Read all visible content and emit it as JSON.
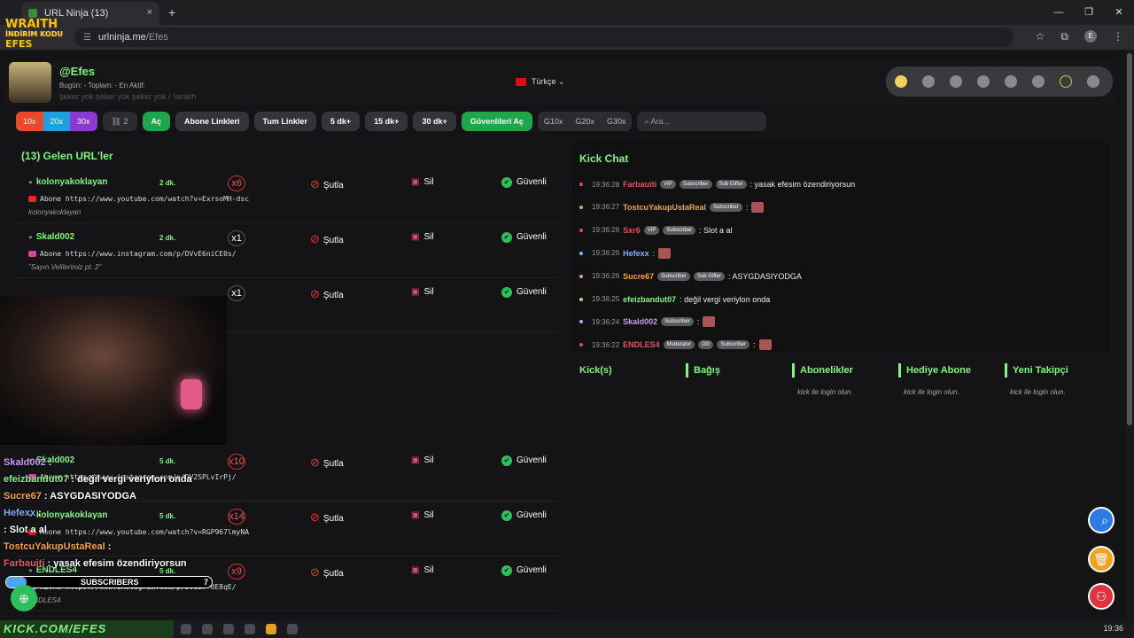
{
  "browser": {
    "tab_title": "URL Ninja (13)",
    "tab_close": "×",
    "new_tab": "+",
    "window_controls": [
      "—",
      "❐",
      "✕"
    ],
    "url_host": "urlninja.me",
    "url_path": "/Efes",
    "profile_initial": "E"
  },
  "overlay_logo": {
    "line1": "WRAITH",
    "line2": "İNDİRİM KODU",
    "line3": "EFES"
  },
  "header": {
    "username": "@Efes",
    "stats": "Bugün:  -   Toplam:  -   En Aktif:",
    "mantra": "şeker yok şeker yok şeker yok / !wraith",
    "language": "Türkçe"
  },
  "toolbar": {
    "multipliers": [
      "10x",
      "20x",
      "30x"
    ],
    "link_count": "2",
    "open_label": "Aç",
    "sub_links_label": "Abone Linkleri",
    "all_links_label": "Tum Linkler",
    "time_filters": [
      "5 dk+",
      "15 dk+",
      "30 dk+"
    ],
    "open_safe_label": "Güvenlileri Aç",
    "group_filters": [
      "G10x",
      "G20x",
      "G30x"
    ],
    "search_placeholder": "Ara..."
  },
  "incoming": {
    "title": "(13) Gelen URL'ler",
    "rows": [
      {
        "user": "kolonyakoklayan",
        "ago": "2 dk.",
        "count": "x6",
        "kick": "Şutla",
        "del": "Sil",
        "safe": "Güvenli",
        "link": "Abone https://www.youtube.com/watch?v=ExrsoMH-dsc",
        "sub": "kolonyakoklayan",
        "type": "yt"
      },
      {
        "user": "Skald002",
        "ago": "2 dk.",
        "count": "x1",
        "kick": "Şutla",
        "del": "Sil",
        "safe": "Güvenli",
        "link": "Abone https://www.instagram.com/p/DVvE6niCE0s/",
        "sub": "\"Sayın Velilerimiz pt. 2\"",
        "type": "ig"
      },
      {
        "user": "",
        "ago": "",
        "count": "x1",
        "kick": "Şutla",
        "del": "Sil",
        "safe": "Güvenli",
        "link": "",
        "sub": "",
        "type": "yt"
      },
      {
        "user": "Skald002",
        "ago": "5 dk.",
        "count": "x10",
        "kick": "Şutla",
        "del": "Sil",
        "safe": "Güvenli",
        "link": "Abone https://www.instagram.com/p/DV2SPLvIrPj/",
        "sub": "",
        "type": "ig"
      },
      {
        "user": "kolonyakoklayan",
        "ago": "5 dk.",
        "count": "x14",
        "kick": "Şutla",
        "del": "Sil",
        "safe": "Güvenli",
        "link": "Abone https://www.youtube.com/watch?v=RGP967lmyNA",
        "sub": "",
        "type": "yt"
      },
      {
        "user": "ENDLES4",
        "ago": "5 dk.",
        "count": "x9",
        "kick": "Şutla",
        "del": "Sil",
        "safe": "Güvenli",
        "link": "Abone https://www.instagram.com/p/DV0zP-dE8qE/",
        "sub": "ENDLES4",
        "type": "ig"
      }
    ]
  },
  "kick_chat": {
    "title": "Kick Chat",
    "messages": [
      {
        "time": "19:36:28",
        "nick": "Farbauiti",
        "nick_color": "#e0506a",
        "badges": [
          "VIP",
          "Subscriber",
          "Sub Gifter"
        ],
        "text": ": yasak efesim özendiriyorsun",
        "dot": "#e44"
      },
      {
        "time": "19:36:27",
        "nick": "TostcuYakupUstaReal",
        "nick_color": "#f2a23a",
        "badges": [
          "Subscriber"
        ],
        "text": ":",
        "dot": "#f2a23a"
      },
      {
        "time": "19:36:26",
        "nick": "Sxr6",
        "nick_color": "#e0506a",
        "badges": [
          "VIP",
          "Subscriber"
        ],
        "text": ": Slot a al",
        "dot": "#e44"
      },
      {
        "time": "19:36:26",
        "nick": "Hefexx",
        "nick_color": "#7fb0ff",
        "badges": [],
        "text": ":",
        "dot": "#7fb0ff"
      },
      {
        "time": "19:36:26",
        "nick": "Sucre67",
        "nick_color": "#f2a23a",
        "badges": [
          "Subscriber",
          "Sub Gifter"
        ],
        "text": ": ASYGDASIYODGA",
        "dot": "#f2a23a"
      },
      {
        "time": "19:36:25",
        "nick": "efeizbandut07",
        "nick_color": "#7ef57b",
        "badges": [],
        "text": ": değil vergi veriylon onda",
        "dot": "#7ef57b"
      },
      {
        "time": "19:36:24",
        "nick": "Skald002",
        "nick_color": "#c59cf5",
        "badges": [
          "Subscriber"
        ],
        "text": ":",
        "dot": "#c59cf5"
      },
      {
        "time": "19:36:22",
        "nick": "ENDLES4",
        "nick_color": "#e0506a",
        "badges": [
          "Moderator",
          "OG",
          "Subscriber"
        ],
        "text": ":",
        "dot": "#e44"
      }
    ]
  },
  "stat_columns": [
    {
      "title": "Kick(s)",
      "msg": ""
    },
    {
      "title": "Bağış",
      "msg": ""
    },
    {
      "title": "Abonelikler",
      "msg": "kick ile login olun."
    },
    {
      "title": "Hediye Abone",
      "msg": "kick ile login olun."
    },
    {
      "title": "Yeni Takipçi",
      "msg": "kick ile login olun."
    }
  ],
  "stream_overlay": {
    "chat": [
      {
        "nick": "Skald002",
        "text": ":",
        "cls": "n1"
      },
      {
        "nick": "efeizbandut07",
        "text": ": değil vergi veriylon onda",
        "cls": "n5"
      },
      {
        "nick": "Sucre67",
        "text": ": ASYGDASIYODGA",
        "cls": "n3"
      },
      {
        "nick": "Hefexx",
        "text": ":",
        "cls": "n2"
      },
      {
        "nick": "",
        "text": ": Slot a al",
        "cls": "n4"
      },
      {
        "nick": "TostcuYakupUstaReal",
        "text": ":",
        "cls": "n3"
      },
      {
        "nick": "Farbauiti",
        "text": ": yasak efesim özendiriyorsun",
        "cls": "n4"
      }
    ],
    "subs_label": "SUBSCRIBERS",
    "subs_count": "7",
    "subs_fill": 0.1,
    "banner": "KICK.COM/EFES"
  },
  "taskbar": {
    "time": "19:36"
  },
  "colors": {
    "accent_green": "#7ef57b",
    "button_green": "#1fa64a",
    "danger": "#e33",
    "fab_search": "#2c7ae5",
    "fab_trash": "#f2a21c",
    "fab_user": "#e3323c"
  }
}
